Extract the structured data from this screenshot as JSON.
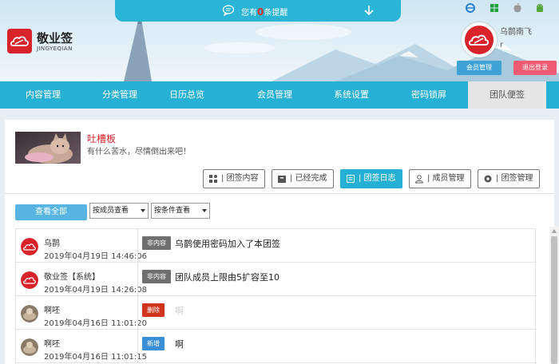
{
  "notice": {
    "prefix": "您有",
    "count": "0",
    "suffix": "条提醒"
  },
  "platforms": [
    "ie-icon",
    "windows-icon",
    "apple-icon",
    "android-icon"
  ],
  "logo": {
    "title": "敬业签",
    "subtitle": "JINGYEQIAN"
  },
  "user": {
    "name": "乌鹊南飞",
    "sub": "r",
    "member_btn": "会员管理",
    "logout_btn": "退出登录"
  },
  "nav": [
    {
      "label": "内容管理"
    },
    {
      "label": "分类管理"
    },
    {
      "label": "日历总览"
    },
    {
      "label": "会员管理"
    },
    {
      "label": "系统设置"
    },
    {
      "label": "密码锁屏"
    },
    {
      "label": "团队便签"
    }
  ],
  "board": {
    "title": "吐槽板",
    "desc": "有什么苦水，尽情倒出来吧！"
  },
  "tools": [
    {
      "label": "| 团签内容",
      "icon": "team-content-icon"
    },
    {
      "label": "| 已经完成",
      "icon": "completed-icon"
    },
    {
      "label": "| 团签日志",
      "icon": "team-log-icon"
    },
    {
      "label": "| 成员管理",
      "icon": "members-icon"
    },
    {
      "label": "| 团签管理",
      "icon": "settings-icon"
    }
  ],
  "filters": {
    "view_all": "查看全部",
    "by_member": "按成员查看",
    "by_condition": "按条件查看"
  },
  "logs": [
    {
      "name": "乌鹊",
      "time": "2019年04月19日 14:46:06",
      "tag": "非内容",
      "tag_color": "#6f6f6f",
      "content": "乌鹊使用密码加入了本团签"
    },
    {
      "name": "敬业签【系统】",
      "time": "2019年04月19日 14:26:08",
      "tag": "非内容",
      "tag_color": "#6f6f6f",
      "content": "团队成员上限由5扩容至10"
    },
    {
      "name": "啊呸",
      "time": "2019年04月16日 11:01:20",
      "tag": "删除",
      "tag_color": "#d0351c",
      "content": "啊"
    },
    {
      "name": "啊呸",
      "time": "2019年04月16日 11:01:15",
      "tag": "新增",
      "tag_color": "#3b8fd6",
      "content": "啊"
    }
  ]
}
